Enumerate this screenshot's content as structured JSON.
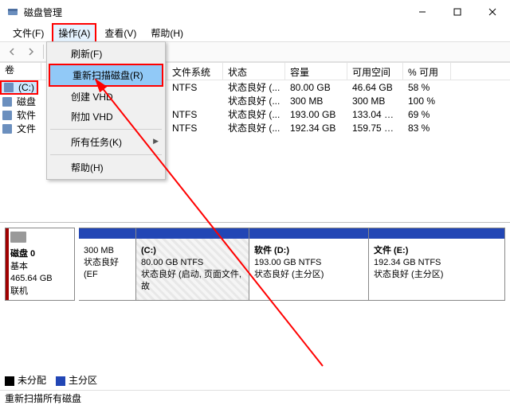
{
  "window": {
    "title": "磁盘管理",
    "icon_name": "disk-icon"
  },
  "menu": {
    "file": "文件(F)",
    "action": "操作(A)",
    "view": "查看(V)",
    "help": "帮助(H)"
  },
  "dropdown": {
    "refresh": "刷新(F)",
    "rescan": "重新扫描磁盘(R)",
    "create_vhd": "创建 VHD",
    "attach_vhd": "附加 VHD",
    "all_tasks": "所有任务(K)",
    "help": "帮助(H)"
  },
  "columns": {
    "volume": "卷",
    "fs": "文件系统",
    "status": "状态",
    "capacity": "容量",
    "free": "可用空间",
    "pct": "% 可用"
  },
  "tree": {
    "c": "(C:)",
    "disk": "磁盘",
    "soft": "软件",
    "file": "文件"
  },
  "rows": [
    {
      "vol": "(C:)",
      "fs": "NTFS",
      "status": "状态良好 (...",
      "cap": "80.00 GB",
      "free": "46.64 GB",
      "pct": "58 %"
    },
    {
      "vol": "磁盘 …",
      "fs": "",
      "status": "状态良好 (...",
      "cap": "300 MB",
      "free": "300 MB",
      "pct": "100 %"
    },
    {
      "vol": "软件 (D:)",
      "fs": "NTFS",
      "status": "状态良好 (...",
      "cap": "193.00 GB",
      "free": "133.04 …",
      "pct": "69 %"
    },
    {
      "vol": "文件 (E:)",
      "fs": "NTFS",
      "status": "状态良好 (...",
      "cap": "192.34 GB",
      "free": "159.75 …",
      "pct": "83 %"
    }
  ],
  "disk": {
    "name": "磁盘 0",
    "type": "基本",
    "size": "465.64 GB",
    "state": "联机"
  },
  "parts": [
    {
      "title": "",
      "line2": "300 MB",
      "line3": "状态良好 (EF",
      "width": 72
    },
    {
      "title": "(C:)",
      "line2": "80.00 GB NTFS",
      "line3": "状态良好 (启动, 页面文件, 故",
      "width": 142,
      "hatched": true
    },
    {
      "title": "软件  (D:)",
      "line2": "193.00 GB NTFS",
      "line3": "状态良好 (主分区)",
      "width": 152
    },
    {
      "title": "文件  (E:)",
      "line2": "192.34 GB NTFS",
      "line3": "状态良好 (主分区)",
      "width": 152
    }
  ],
  "legend": {
    "unalloc": "未分配",
    "primary": "主分区"
  },
  "status": "重新扫描所有磁盘"
}
